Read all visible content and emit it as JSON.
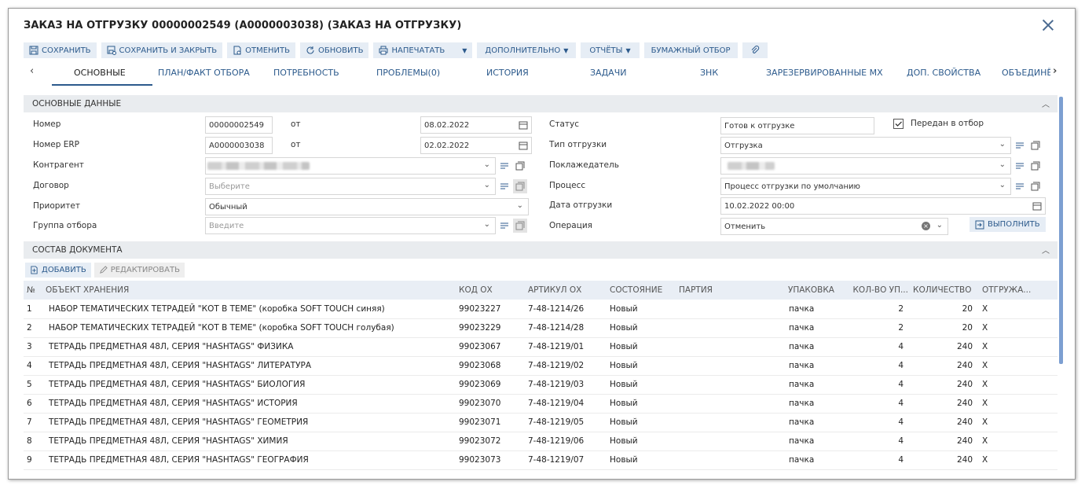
{
  "window": {
    "title": "ЗАКАЗ НА ОТГРУЗКУ 00000002549 (A0000003038) (ЗАКАЗ НА ОТГРУЗКУ)"
  },
  "toolbar": {
    "save": "СОХРАНИТЬ",
    "save_close": "СОХРАНИТЬ И ЗАКРЫТЬ",
    "cancel": "ОТМЕНИТЬ",
    "refresh": "ОБНОВИТЬ",
    "print": "НАПЕЧАТАТЬ",
    "more": "ДОПОЛНИТЕЛЬНО",
    "reports": "ОТЧЁТЫ",
    "paper": "БУМАЖНЫЙ ОТБОР"
  },
  "tabs": [
    {
      "label": "ОСНОВНЫЕ"
    },
    {
      "label": "ПЛАН/ФАКТ ОТБОРА"
    },
    {
      "label": "ПОТРЕБНОСТЬ"
    },
    {
      "label": "ПРОБЛЕМЫ(0)"
    },
    {
      "label": "ИСТОРИЯ"
    },
    {
      "label": "ЗАДАЧИ"
    },
    {
      "label": "ЗНК"
    },
    {
      "label": "ЗАРЕЗЕРВИРОВАННЫЕ МХ"
    },
    {
      "label": "ДОП. СВОЙСТВА"
    },
    {
      "label": "ОБЪЕДИНЁ"
    }
  ],
  "main_section": {
    "title": "ОСНОВНЫЕ ДАННЫЕ"
  },
  "form": {
    "number_label": "Номер",
    "number_value": "00000002549",
    "from_label": "от",
    "number_date": "08.02.2022",
    "erp_label": "Номер ERP",
    "erp_value": "A0000003038",
    "erp_from_label": "от",
    "erp_date": "02.02.2022",
    "counterparty_label": "Контрагент",
    "contract_label": "Договор",
    "contract_placeholder": "Выберите",
    "priority_label": "Приоритет",
    "priority_value": "Обычный",
    "group_label": "Группа отбора",
    "group_placeholder": "Введите",
    "status_label": "Статус",
    "status_value": "Готов к отгрузке",
    "transferred_label": "Передан в отбор",
    "ship_type_label": "Тип отгрузки",
    "ship_type_value": "Отгрузка",
    "baggager_label": "Поклажедатель",
    "process_label": "Процесс",
    "process_value": "Процесс отгрузки по умолчанию",
    "ship_date_label": "Дата отгрузки",
    "ship_date_value": "10.02.2022 00:00",
    "operation_label": "Операция",
    "operation_value": "Отменить",
    "execute": "ВЫПОЛНИТЬ"
  },
  "doc_section": {
    "title": "СОСТАВ ДОКУМЕНТА",
    "add": "ДОБАВИТЬ",
    "edit": "РЕДАКТИРОВАТЬ"
  },
  "table": {
    "headers": [
      "№",
      "ОБЪЕКТ ХРАНЕНИЯ",
      "КОД ОХ",
      "АРТИКУЛ ОХ",
      "СОСТОЯНИЕ",
      "ПАРТИЯ",
      "УПАКОВКА",
      "КОЛ-ВО УП...",
      "КОЛИЧЕСТВО",
      "ОТГРУЖА..."
    ],
    "rows": [
      [
        "1",
        "НАБОР ТЕМАТИЧЕСКИХ ТЕТРАДЕЙ \"КОТ В ТЕМЕ\" (коробка SOFT TOUCH синяя)",
        "99023227",
        "7-48-1214/26",
        "Новый",
        "",
        "пачка",
        "2",
        "20",
        "X"
      ],
      [
        "2",
        "НАБОР ТЕМАТИЧЕСКИХ ТЕТРАДЕЙ \"КОТ В ТЕМЕ\" (коробка SOFT TOUCH голубая)",
        "99023229",
        "7-48-1214/28",
        "Новый",
        "",
        "пачка",
        "2",
        "20",
        "X"
      ],
      [
        "3",
        "ТЕТРАДЬ ПРЕДМЕТНАЯ 48Л, СЕРИЯ \"HASHTAGS\" ФИЗИКА",
        "99023067",
        "7-48-1219/01",
        "Новый",
        "",
        "пачка",
        "4",
        "240",
        "X"
      ],
      [
        "4",
        "ТЕТРАДЬ ПРЕДМЕТНАЯ 48Л, СЕРИЯ \"HASHTAGS\" ЛИТЕРАТУРА",
        "99023068",
        "7-48-1219/02",
        "Новый",
        "",
        "пачка",
        "4",
        "240",
        "X"
      ],
      [
        "5",
        "ТЕТРАДЬ ПРЕДМЕТНАЯ 48Л, СЕРИЯ \"HASHTAGS\" БИОЛОГИЯ",
        "99023069",
        "7-48-1219/03",
        "Новый",
        "",
        "пачка",
        "4",
        "240",
        "X"
      ],
      [
        "6",
        "ТЕТРАДЬ ПРЕДМЕТНАЯ 48Л, СЕРИЯ \"HASHTAGS\" ИСТОРИЯ",
        "99023070",
        "7-48-1219/04",
        "Новый",
        "",
        "пачка",
        "4",
        "240",
        "X"
      ],
      [
        "7",
        "ТЕТРАДЬ ПРЕДМЕТНАЯ 48Л, СЕРИЯ \"HASHTAGS\" ГЕОМЕТРИЯ",
        "99023071",
        "7-48-1219/05",
        "Новый",
        "",
        "пачка",
        "4",
        "240",
        "X"
      ],
      [
        "8",
        "ТЕТРАДЬ ПРЕДМЕТНАЯ 48Л, СЕРИЯ \"HASHTAGS\" ХИМИЯ",
        "99023072",
        "7-48-1219/06",
        "Новый",
        "",
        "пачка",
        "4",
        "240",
        "X"
      ],
      [
        "9",
        "ТЕТРАДЬ ПРЕДМЕТНАЯ 48Л, СЕРИЯ \"HASHTAGS\" ГЕОГРАФИЯ",
        "99023073",
        "7-48-1219/07",
        "Новый",
        "",
        "пачка",
        "4",
        "240",
        "X"
      ]
    ]
  },
  "colors": {
    "accent": "#2c5a8c",
    "button_bg": "#e6edf5",
    "section_bg": "#e9ecef",
    "scrollbar": "#7d9fd1"
  }
}
